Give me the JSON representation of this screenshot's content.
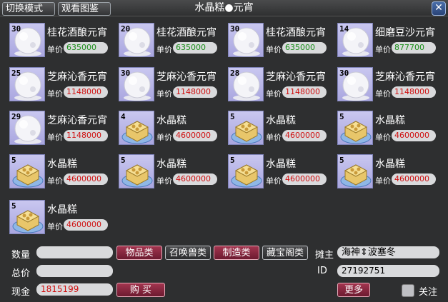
{
  "titlebar": {
    "mode_button": "切换模式",
    "gallery_button": "观看图鉴",
    "title": "水晶糕●元宵",
    "close_glyph": "✕"
  },
  "items": [
    {
      "qty": "30",
      "name": "桂花酒酿元宵",
      "price_label": "单价",
      "price": "635000",
      "icon": "snowball-icon",
      "price_color": "#1a8f1a"
    },
    {
      "qty": "20",
      "name": "桂花酒酿元宵",
      "price_label": "单价",
      "price": "635000",
      "icon": "snowball-icon",
      "price_color": "#1a8f1a"
    },
    {
      "qty": "30",
      "name": "桂花酒酿元宵",
      "price_label": "单价",
      "price": "635000",
      "icon": "snowball-icon",
      "price_color": "#1a8f1a"
    },
    {
      "qty": "14",
      "name": "细磨豆沙元宵",
      "price_label": "单价",
      "price": "877700",
      "icon": "snowball-icon",
      "price_color": "#1a8f1a"
    },
    {
      "qty": "25",
      "name": "芝麻沁香元宵",
      "price_label": "单价",
      "price": "1148000",
      "icon": "snowball-icon",
      "price_color": "#d01010"
    },
    {
      "qty": "30",
      "name": "芝麻沁香元宵",
      "price_label": "单价",
      "price": "1148000",
      "icon": "snowball-icon",
      "price_color": "#d01010"
    },
    {
      "qty": "28",
      "name": "芝麻沁香元宵",
      "price_label": "单价",
      "price": "1148000",
      "icon": "snowball-icon",
      "price_color": "#d01010"
    },
    {
      "qty": "30",
      "name": "芝麻沁香元宵",
      "price_label": "单价",
      "price": "1148000",
      "icon": "snowball-icon",
      "price_color": "#d01010"
    },
    {
      "qty": "29",
      "name": "芝麻沁香元宵",
      "price_label": "单价",
      "price": "1148000",
      "icon": "snowball-icon",
      "price_color": "#d01010"
    },
    {
      "qty": "4",
      "name": "水晶糕",
      "price_label": "单价",
      "price": "4600000",
      "icon": "crystal-cake-icon",
      "price_color": "#d01010"
    },
    {
      "qty": "5",
      "name": "水晶糕",
      "price_label": "单价",
      "price": "4600000",
      "icon": "crystal-cake-icon",
      "price_color": "#d01010"
    },
    {
      "qty": "5",
      "name": "水晶糕",
      "price_label": "单价",
      "price": "4600000",
      "icon": "crystal-cake-icon",
      "price_color": "#d01010"
    },
    {
      "qty": "5",
      "name": "水晶糕",
      "price_label": "单价",
      "price": "4600000",
      "icon": "crystal-cake-icon",
      "price_color": "#d01010"
    },
    {
      "qty": "5",
      "name": "水晶糕",
      "price_label": "单价",
      "price": "4600000",
      "icon": "crystal-cake-icon",
      "price_color": "#d01010"
    },
    {
      "qty": "5",
      "name": "水晶糕",
      "price_label": "单价",
      "price": "4600000",
      "icon": "crystal-cake-icon",
      "price_color": "#d01010"
    },
    {
      "qty": "5",
      "name": "水晶糕",
      "price_label": "单价",
      "price": "4600000",
      "icon": "crystal-cake-icon",
      "price_color": "#d01010"
    },
    {
      "qty": "5",
      "name": "水晶糕",
      "price_label": "单价",
      "price": "4600000",
      "icon": "crystal-cake-icon",
      "price_color": "#d01010"
    }
  ],
  "bottom": {
    "quantity_label": "数量",
    "quantity_value": "",
    "total_label": "总价",
    "total_value": "",
    "cash_label": "现金",
    "cash_value": "1815199",
    "buy_button": "购 买",
    "categories": [
      "物品类",
      "召唤兽类",
      "制造类",
      "藏宝阁类"
    ],
    "owner_label": "摊主",
    "owner_value": "海神⇕波塞冬",
    "id_label": "ID",
    "id_value": "27192751",
    "more_button": "更多",
    "follow_label": "关注"
  },
  "colors": {
    "cash_color": "#d01010",
    "accent_red": "#8b2440",
    "icon_bg": "#b8b6ea"
  }
}
